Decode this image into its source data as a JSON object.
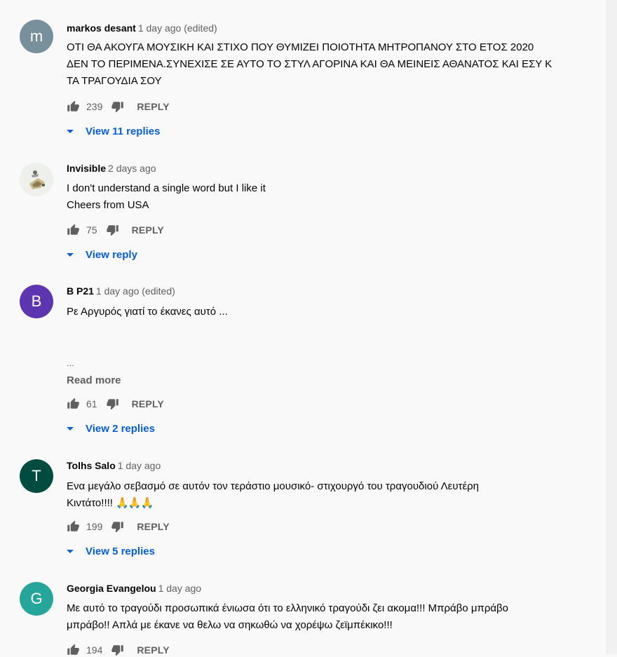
{
  "comments": [
    {
      "author": "markos desant",
      "time": "1 day ago (edited)",
      "avatar_letter": "m",
      "avatar_color": "#78909c",
      "lines": [
        "ΟΤΙ ΘΑ ΑΚΟΥΓΑ ΜΟΥΣΙΚΗ ΚΑΙ ΣΤΙΧΟ  ΠΟΥ ΘΥΜΙΖΕΙ ΠΟΙΟΤΗΤΑ ΜΗΤΡΟΠΑΝΟΥ ΣΤΟ ΕΤΟΣ 2020",
        "ΔΕΝ ΤΟ ΠΕΡΙΜΕΝΑ.ΣΥΝΕΧΙΣΕ ΣΕ ΑΥΤΟ ΤΟ ΣΤΥΛ ΑΓΟΡΙΝΑ ΚΑΙ ΘΑ ΜΕΙΝΕΙΣ ΑΘΑΝΑΤΟΣ ΚΑΙ ΕΣΥ Κ",
        "ΤΑ ΤΡΑΓΟΥΔΙΑ ΣΟΥ"
      ],
      "likes": "239",
      "reply_label": "REPLY",
      "replies_label": "View 11 replies"
    },
    {
      "author": "Invisible",
      "time": "2 days ago",
      "avatar_letter": "",
      "avatar_color": "#eef0ec",
      "lines": [
        "I don't understand a single word but I like it",
        "Cheers from USA"
      ],
      "likes": "75",
      "reply_label": "REPLY",
      "replies_label": "View reply"
    },
    {
      "author": "B P21",
      "time": "1 day ago (edited)",
      "avatar_letter": "B",
      "avatar_color": "#5e35b1",
      "lines": [
        "Ρε Αργυρός γιατί το έκανες αυτό ..."
      ],
      "ellipsis": "...",
      "read_more": "Read more",
      "likes": "61",
      "reply_label": "REPLY",
      "replies_label": "View 2 replies"
    },
    {
      "author": "Tolhs Salo",
      "time": "1 day ago",
      "avatar_letter": "T",
      "avatar_color": "#004d40",
      "lines": [
        "Ενα μεγάλο σεβασμό  σε αυτόν τον τεράστιο μουσικό- στιχουργό του  τραγουδιού Λευτέρη",
        "Κιντάτο!!!! "
      ],
      "emoji": "🙏🙏🙏",
      "likes": "199",
      "reply_label": "REPLY",
      "replies_label": "View 5 replies"
    },
    {
      "author": "Georgia Evangelou",
      "time": "1 day ago",
      "avatar_letter": "G",
      "avatar_color": "#26a69a",
      "lines": [
        "Με αυτό το τραγούδι προσωπικά ένιωσα ότι το ελληνικό τραγούδι ζει ακομα!!! Μπράβο μπράβο",
        "μπράβο!! Απλά με έκανε να θελω να σηκωθώ να χορέψω ζεϊμπέκικο!!!"
      ],
      "likes": "194",
      "reply_label": "REPLY"
    }
  ]
}
